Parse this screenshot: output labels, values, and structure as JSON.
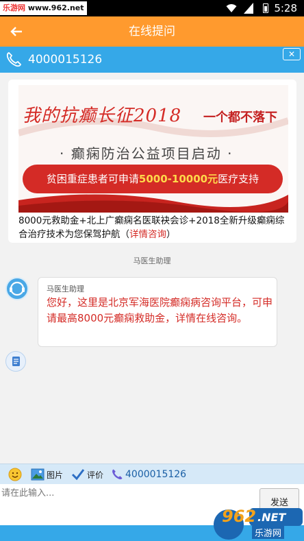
{
  "status_bar": {
    "watermark_site": "乐游网",
    "watermark_url": "www.962.net",
    "time": "5:28"
  },
  "header": {
    "back_icon": "arrow-left-icon",
    "title": "在线提问"
  },
  "phone_bar": {
    "phone_icon": "phone-icon",
    "number": "4000015126",
    "close_label": "✕"
  },
  "banner_card": {
    "banner_title": "我的抗癫长征2018",
    "banner_slogan": "一个都不落下",
    "banner_subtitle": "· 癫痫防治公益项目启动 ·",
    "banner_pill_prefix": "贫困重症患者可申请",
    "banner_pill_amount": "5000-10000元",
    "banner_pill_suffix": "医疗支持",
    "description": "8000元救助金+北上广癫痫名医联袂会诊+2018全新升级癫痫综合治疗技术为您保驾护航（",
    "link_text": "详情咨询",
    "description_end": "）"
  },
  "chat": {
    "sender_label": "马医生助理",
    "message": {
      "name": "马医生助理",
      "text": "您好，这里是北京军海医院癫痫病咨询平台，可申请最高8000元癫痫救助金，详情在线咨询。"
    }
  },
  "toolbar": {
    "emoji_icon": "emoji-icon",
    "image_label": "图片",
    "rate_label": "评价",
    "phone_number": "4000015126"
  },
  "input": {
    "placeholder": "请在此输入...",
    "send_label": "发送"
  },
  "bottom_watermark": {
    "brand": "962",
    "domain": ".NET",
    "name": "乐游网"
  },
  "colors": {
    "header": "#ff9a2e",
    "phone_bar": "#35a8e8",
    "message_text": "#d42b26",
    "toolbar": "#d6e9f8"
  }
}
